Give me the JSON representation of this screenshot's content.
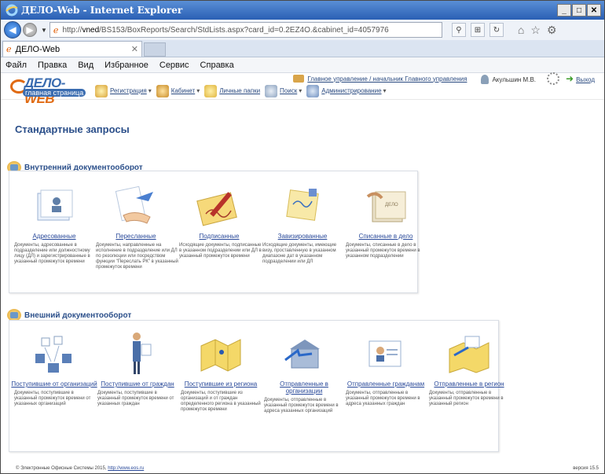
{
  "window": {
    "title": "ДЕЛО-Web - Internet Explorer"
  },
  "address": {
    "url_prefix": "http://",
    "url_host": "vned",
    "url_rest": "/BS153/BoxReports/Search/StdLists.aspx?card_id=0.2EZ4O.&cabinet_id=4057976"
  },
  "tab": {
    "label": "ДЕЛО-Web"
  },
  "menu": [
    "Файл",
    "Правка",
    "Вид",
    "Избранное",
    "Сервис",
    "Справка"
  ],
  "app": {
    "logo_main": "ДЕЛО-",
    "logo_web": "WEB",
    "logo_sub": "главная страница",
    "nav": [
      "Регистрация",
      "Кабинет",
      "Личные папки",
      "Поиск",
      "Администрирование"
    ],
    "department": "Главное управление / начальник Главного управления",
    "user": "Акульшин М.В.",
    "exit": "Выход"
  },
  "page": {
    "title": "Стандартные запросы",
    "internal": {
      "title": "Внутренний документооборот",
      "cards": [
        {
          "label": "Адресованные",
          "desc": "Документы, адресованные в подразделение или должностному лицу (ДЛ) и зарегистрированные в указанный промежуток времени"
        },
        {
          "label": "Пересланные",
          "desc": "Документы, направленные на исполнение в подразделение или ДЛ по резолюции или посредством функции \"Переслать РК\" в указанный промежуток времени"
        },
        {
          "label": "Подписанные",
          "desc": "Исходящие документы, подписанные в указанном подразделении или ДЛ в указанный промежуток времени"
        },
        {
          "label": "Завизированные",
          "desc": "Исходящие документы, имеющие визу, проставленную в указанном диапазоне дат в указанном подразделении или ДЛ"
        },
        {
          "label": "Списанные в дело",
          "desc": "Документы, списанные в дело в указанный промежуток времени в указанном подразделении"
        }
      ]
    },
    "external": {
      "title": "Внешний документооборот",
      "cards": [
        {
          "label": "Поступившие от организаций",
          "desc": "Документы, поступившие в указанный промежуток времени от указанных организаций"
        },
        {
          "label": "Поступившие от граждан",
          "desc": "Документы, поступившие в указанный промежуток времени от указанных граждан"
        },
        {
          "label": "Поступившие из региона",
          "desc": "Документы, поступившие из организаций и от граждан определенного региона в указанный промежуток времени"
        },
        {
          "label": "Отправленные в организации",
          "desc": "Документы, отправленные в указанный промежуток времени в адреса указанных организаций"
        },
        {
          "label": "Отправленные гражданам",
          "desc": "Документы, отправленные в указанный промежуток времени в адреса указанных граждан"
        },
        {
          "label": "Отправленные в регион",
          "desc": "Документы, отправленные в указанный промежуток времени в указанный регион"
        }
      ]
    }
  },
  "footer": {
    "text": "© Электронные Офисные Системы 2015,",
    "link": "http://www.eos.ru",
    "version": "версия 15.5"
  }
}
